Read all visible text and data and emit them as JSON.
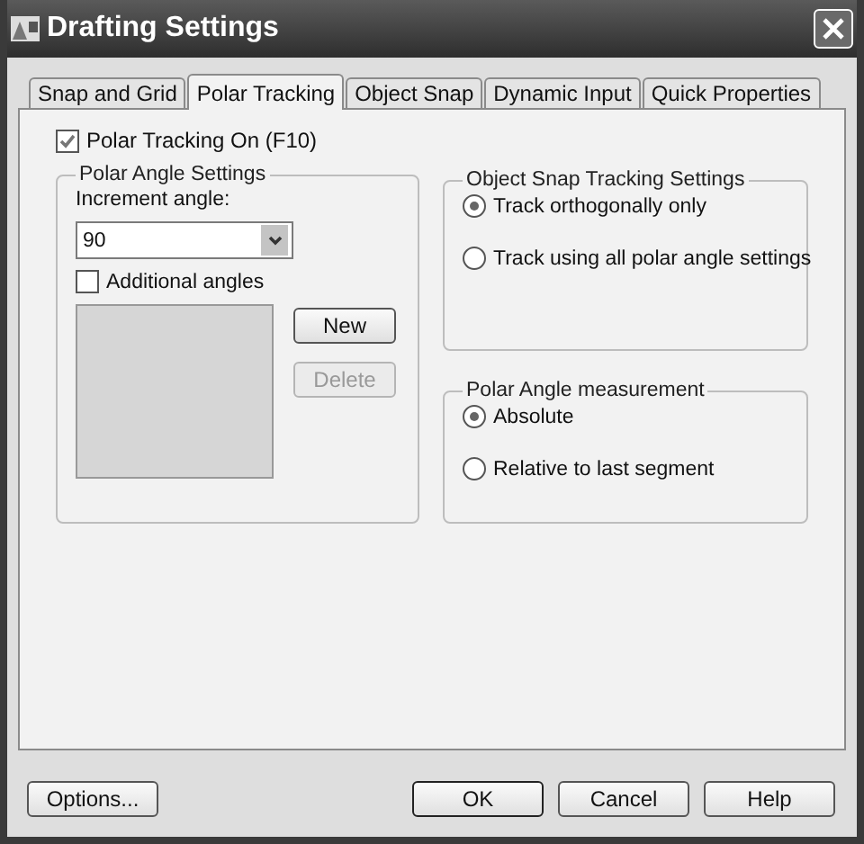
{
  "window": {
    "title": "Drafting Settings"
  },
  "tabs": [
    {
      "label": "Snap and Grid",
      "selected": false
    },
    {
      "label": "Polar Tracking",
      "selected": true
    },
    {
      "label": "Object Snap",
      "selected": false
    },
    {
      "label": "Dynamic Input",
      "selected": false
    },
    {
      "label": "Quick Properties",
      "selected": false
    }
  ],
  "polar_tracking_on": {
    "label": "Polar Tracking On (F10)",
    "checked": true
  },
  "polar_angle_settings": {
    "title": "Polar Angle Settings",
    "increment_label": "Increment angle:",
    "increment_value": "90",
    "additional_angles": {
      "label": "Additional angles",
      "checked": false
    },
    "buttons": [
      {
        "label": "New",
        "disabled": false
      },
      {
        "label": "Delete",
        "disabled": true
      }
    ]
  },
  "object_snap_tracking_settings": {
    "title": "Object Snap Tracking Settings",
    "options": [
      {
        "label": "Track orthogonally only",
        "selected": true
      },
      {
        "label": "Track using all polar angle settings",
        "selected": false
      }
    ]
  },
  "polar_angle_measurement": {
    "title": "Polar Angle measurement",
    "options": [
      {
        "label": "Absolute",
        "selected": true
      },
      {
        "label": "Relative to last segment",
        "selected": false
      }
    ]
  },
  "footer": {
    "options_button": "Options...",
    "buttons": [
      {
        "label": "OK",
        "default": true
      },
      {
        "label": "Cancel",
        "default": false
      },
      {
        "label": "Help",
        "default": false
      }
    ]
  }
}
